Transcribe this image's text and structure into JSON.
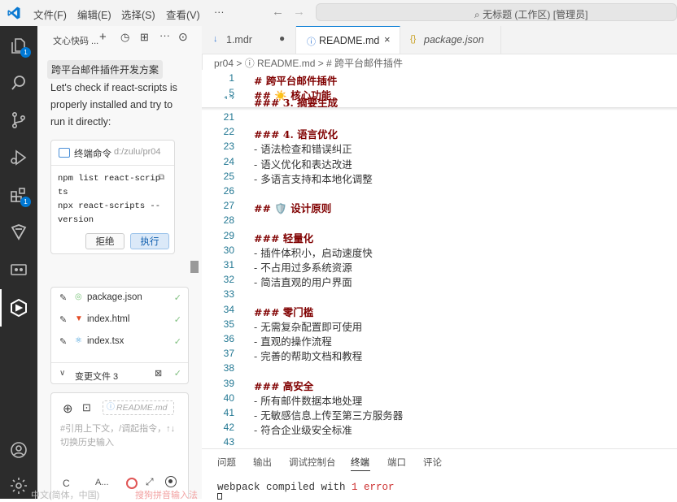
{
  "titlebar": {
    "menus": [
      "文件(F)",
      "编辑(E)",
      "选择(S)",
      "查看(V)",
      "···"
    ],
    "command_center": "无标题 (工作区) [管理员]"
  },
  "activity_bar": {
    "items": [
      {
        "name": "explorer",
        "badge": "1"
      },
      {
        "name": "search"
      },
      {
        "name": "source-control"
      },
      {
        "name": "run-debug"
      },
      {
        "name": "extensions",
        "badge": "1"
      },
      {
        "name": "remote"
      },
      {
        "name": "terminal-view"
      },
      {
        "name": "ai-assistant",
        "active": true
      },
      {
        "name": "account"
      },
      {
        "name": "settings"
      }
    ]
  },
  "sidebar": {
    "title": "文心快码 ...",
    "chat_title": "跨平台邮件插件开发方案",
    "message": "Let's check if react-scripts is properly installed and try to run it directly:",
    "terminal_card": {
      "label": "终端命令",
      "path": "d:/zulu/pr04",
      "commands": [
        "npm list react-scripts",
        "npx react-scripts --version"
      ],
      "reject": "拒绝",
      "run": "执行"
    },
    "files": [
      {
        "name": "package.json",
        "icon": "npm-icon"
      },
      {
        "name": "index.html",
        "icon": "html5-icon"
      },
      {
        "name": "index.tsx",
        "icon": "react-icon"
      }
    ],
    "changed_files": "变更文件 3",
    "input": {
      "context_chip": "README.md",
      "placeholder": "#引用上下文，/调起指令，↑↓切换历史输入",
      "mode": "C",
      "model": "A..."
    }
  },
  "tabs": [
    {
      "label": "1.mdr",
      "icon": "↓",
      "dirty": true
    },
    {
      "label": "README.md",
      "icon": "ⓘ",
      "active": true
    },
    {
      "label": "package.json",
      "icon": "{}",
      "italic": true
    }
  ],
  "breadcrumb": "pr04 > ⓘ README.md > # 跨平台邮件插件",
  "editor": {
    "sticky": [
      {
        "ln": "1",
        "text": "# 跨平台邮件插件"
      },
      {
        "ln": "5",
        "text": "## ☀️ 核心功能"
      },
      {
        "ln": "17",
        "text": "### 3. 摘要生成"
      }
    ],
    "lines": [
      {
        "ln": "21",
        "kind": "blank",
        "text": ""
      },
      {
        "ln": "22",
        "kind": "h",
        "text": "### 4. 语言优化"
      },
      {
        "ln": "23",
        "kind": "li",
        "text": "- 语法检查和错误纠正"
      },
      {
        "ln": "24",
        "kind": "li",
        "text": "- 语义优化和表达改进"
      },
      {
        "ln": "25",
        "kind": "li",
        "text": "- 多语言支持和本地化调整"
      },
      {
        "ln": "26",
        "kind": "blank",
        "text": ""
      },
      {
        "ln": "27",
        "kind": "h",
        "text": "## 🛡️ 设计原则"
      },
      {
        "ln": "28",
        "kind": "blank",
        "text": ""
      },
      {
        "ln": "29",
        "kind": "h",
        "text": "### 轻量化"
      },
      {
        "ln": "30",
        "kind": "li",
        "text": "- 插件体积小，启动速度快"
      },
      {
        "ln": "31",
        "kind": "li",
        "text": "- 不占用过多系统资源"
      },
      {
        "ln": "32",
        "kind": "li",
        "text": "- 简洁直观的用户界面"
      },
      {
        "ln": "33",
        "kind": "blank",
        "text": ""
      },
      {
        "ln": "34",
        "kind": "h",
        "text": "### 零门槛"
      },
      {
        "ln": "35",
        "kind": "li",
        "text": "- 无需复杂配置即可使用"
      },
      {
        "ln": "36",
        "kind": "li",
        "text": "- 直观的操作流程"
      },
      {
        "ln": "37",
        "kind": "li",
        "text": "- 完善的帮助文档和教程"
      },
      {
        "ln": "38",
        "kind": "blank",
        "text": ""
      },
      {
        "ln": "39",
        "kind": "h",
        "text": "### 高安全"
      },
      {
        "ln": "40",
        "kind": "li",
        "text": "- 所有邮件数据本地处理"
      },
      {
        "ln": "41",
        "kind": "li",
        "text": "- 无敏感信息上传至第三方服务器"
      },
      {
        "ln": "42",
        "kind": "li",
        "text": "- 符合企业级安全标准"
      },
      {
        "ln": "43",
        "kind": "blank",
        "text": ""
      }
    ]
  },
  "panel": {
    "tabs": [
      "问题",
      "输出",
      "调试控制台",
      "终端",
      "端口",
      "评论"
    ],
    "active_tab": "终端",
    "output_prefix": "webpack compiled with ",
    "output_error": "1 error"
  },
  "status_ghost": {
    "ime": "中文(简体，中国)",
    "sogou": "搜狗拼音输入法"
  },
  "colors": {
    "activity_bg": "#2c2c2c",
    "accent": "#0078d4",
    "heading": "#800000",
    "line_number": "#237893",
    "error": "#cd3131"
  }
}
